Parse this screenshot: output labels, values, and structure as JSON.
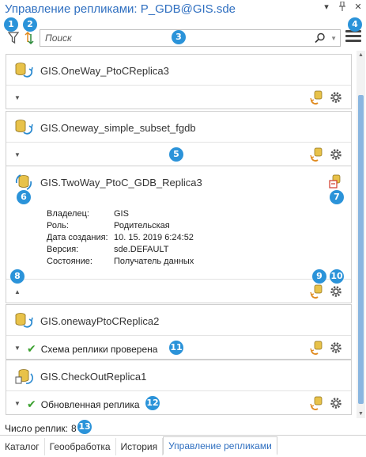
{
  "window": {
    "title": "Управление репликами: P_GDB@GIS.sde",
    "pin_icon": "pin-icon",
    "close_icon": "close-icon",
    "dropdown_icon": "chevron-down-icon"
  },
  "toolbar": {
    "filter_icon": "filter-icon",
    "sort_icon": "sort-icon",
    "search_placeholder": "Поиск",
    "search_value": "",
    "menu_icon": "hamburger-menu-icon"
  },
  "callouts": [
    "1",
    "2",
    "3",
    "4",
    "5",
    "6",
    "7",
    "8",
    "9",
    "10",
    "11",
    "12",
    "13"
  ],
  "replicas": [
    {
      "name": "GIS.OneWay_PtoCReplica3",
      "status": ""
    },
    {
      "name": "GIS.Oneway_simple_subset_fgdb",
      "status": ""
    },
    {
      "name": "GIS.TwoWay_PtoC_GDB_Replica3",
      "expanded": true,
      "details": [
        {
          "label": "Владелец:",
          "value": "GIS"
        },
        {
          "label": "Роль:",
          "value": "Родительская"
        },
        {
          "label": "Дата создания:",
          "value": "10. 15. 2019 6:24:52"
        },
        {
          "label": "Версия:",
          "value": "sde.DEFAULT"
        },
        {
          "label": "Состояние:",
          "value": "Получатель данных"
        }
      ]
    },
    {
      "name": "GIS.onewayPtoCReplica2",
      "status": "Схема реплики проверена"
    },
    {
      "name": "GIS.CheckOutReplica1",
      "status": "Обновленная реплика"
    }
  ],
  "footer": {
    "count_label": "Число реплик:",
    "count_value": "8"
  },
  "tabs": [
    {
      "label": "Каталог",
      "active": false
    },
    {
      "label": "Геообработка",
      "active": false
    },
    {
      "label": "История",
      "active": false
    },
    {
      "label": "Управление репликами",
      "active": true
    }
  ],
  "colors": {
    "accent": "#2f6fc0",
    "badge": "#2b93d9",
    "check": "#3aa02e",
    "db_yellow": "#e8c24a",
    "sync_orange": "#e08a1e",
    "sync_blue": "#2b8ad0"
  }
}
